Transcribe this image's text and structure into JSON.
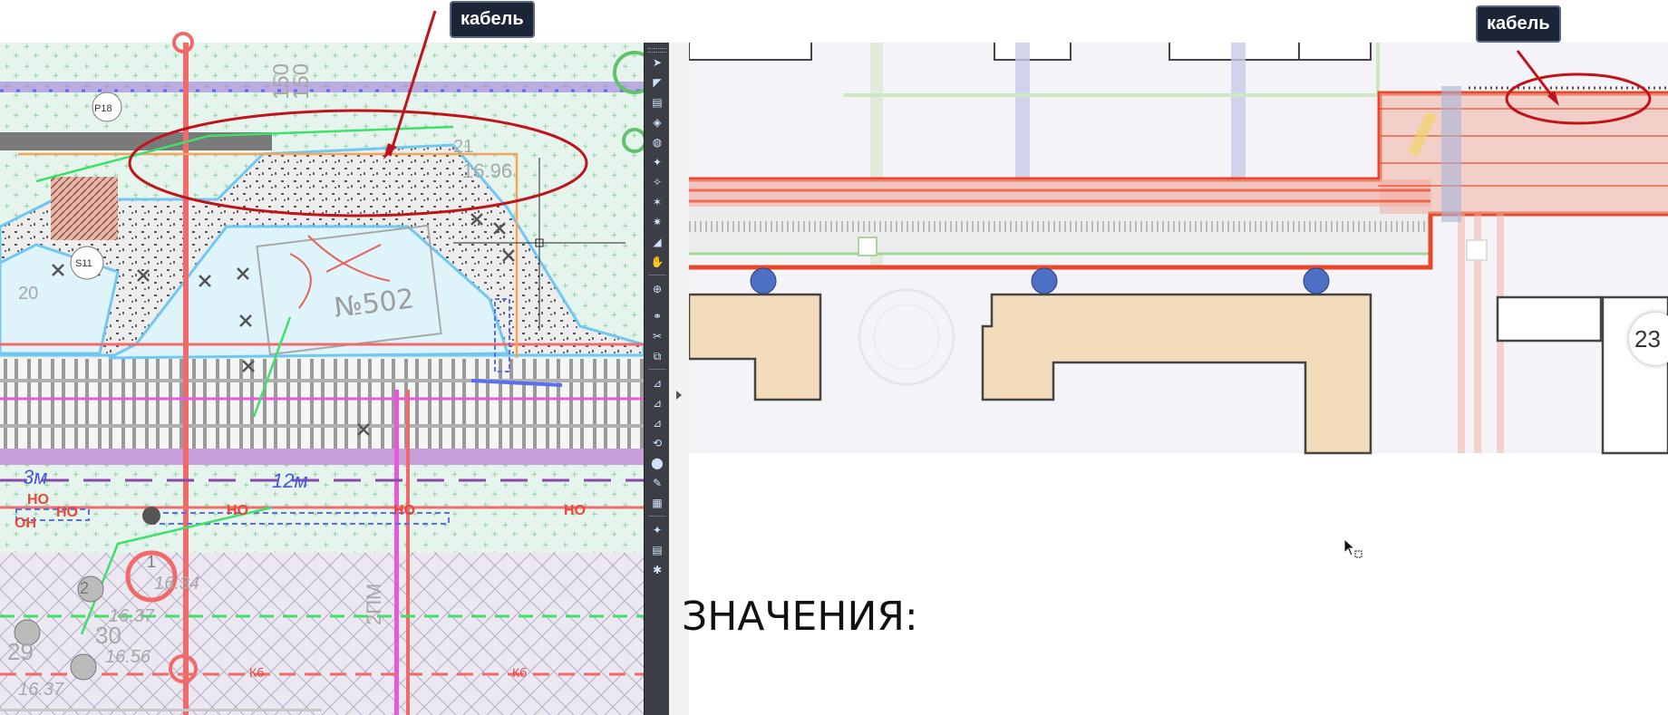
{
  "left_panel": {
    "callout_label": "кабель",
    "plan_labels": {
      "parcel_number": "№502",
      "level_top": "16.96",
      "level_a": "16.37",
      "level_b": "16.56",
      "level_c": "16.34",
      "level_d": "16.37",
      "dist_a": "3м",
      "dist_b": "12м",
      "tag_ho_1": "НО",
      "tag_ho_2": "НО",
      "tag_ho_3": "НО",
      "tag_ho_4": "НО",
      "tag_ho_5": "НО",
      "tag_ok": "ОН",
      "tag_kb_1": "Кб",
      "tag_kb_2": "Кб",
      "marker_p": "Р18",
      "marker_s": "S11",
      "marker_20": "20",
      "marker_21": "21",
      "marker_29": "29",
      "marker_30": "30",
      "marker_2": "2",
      "marker_1": "1",
      "vert_text": "2ПМ",
      "marker_150_a": "150",
      "marker_150_b": "150"
    }
  },
  "toolbar": {
    "tools": [
      "pointer-tool",
      "select-tool",
      "copy-tool",
      "layers-tool",
      "globe-tool",
      "snap-tool",
      "snap-tool-2",
      "snap-tool-3",
      "snap-tool-4",
      "measure-tool",
      "grab-tool",
      "zoom-tool",
      "link-tool",
      "cut-tool",
      "paste-tool",
      "scale-tool",
      "scale-tool-2",
      "scale-tool-3",
      "rotate-tool",
      "stamp-tool",
      "mark-tool",
      "ruler-tool",
      "view-tool",
      "copy-tool-2",
      "grid-tool"
    ]
  },
  "right_panel": {
    "callout_label": "кабель",
    "page_badge": "23",
    "heading": "ЗНАЧЕНИЯ:"
  },
  "colors": {
    "highlight_red": "#e8472a",
    "annotation_red": "#c0141c",
    "building_fill": "#f2dcbc",
    "marker_blue": "#4d6fc4",
    "toolbar_bg": "#3b3e44",
    "callout_bg": "#1b2536"
  }
}
